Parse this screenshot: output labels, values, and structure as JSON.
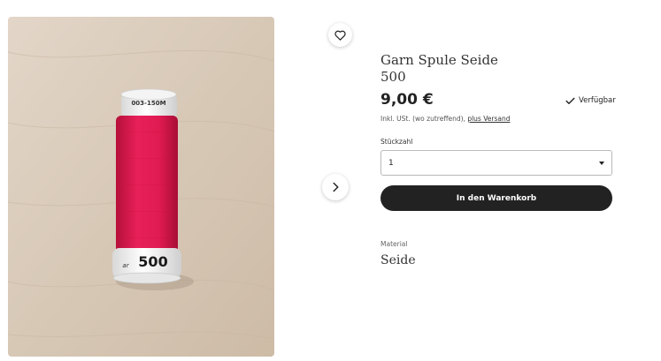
{
  "product": {
    "title_line1": "Garn Spule Seide",
    "title_line2": "500",
    "price": "9,00 €",
    "availability": "Verfügbar",
    "tax_note": "Inkl. USt. (wo zutreffend), ",
    "shipping_link": "plus Versand"
  },
  "image": {
    "spool_top_label": "003-150M",
    "spool_bottom_label": "500",
    "thread_color": "#e2184e",
    "background_color": "#d8c9b8"
  },
  "quantity": {
    "label": "Stückzahl",
    "selected": "1"
  },
  "cart": {
    "button_label": "In den Warenkorb"
  },
  "attributes": {
    "material_label": "Material",
    "material_value": "Seide"
  },
  "icons": {
    "favorite": "heart-icon",
    "next": "chevron-right-icon",
    "availability": "check-icon",
    "dropdown": "chevron-down-icon"
  }
}
